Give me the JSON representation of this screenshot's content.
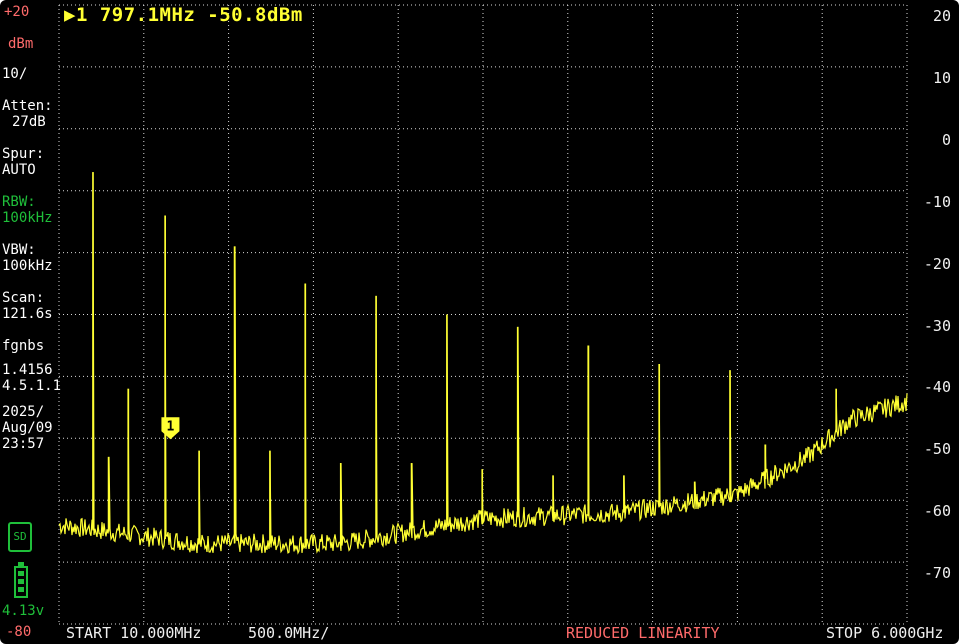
{
  "colors": {
    "trace": "#ffff33",
    "grid": "#ffffff",
    "accent_red": "#ff6b6b",
    "accent_green": "#1fbf3a",
    "text": "#ffffff"
  },
  "marker": {
    "readout": "▶1  797.1MHz -50.8dBm",
    "label": "1"
  },
  "left_panel": {
    "ref_top": "+20",
    "unit": "dBm",
    "scale": "10/",
    "atten_label": "Atten:",
    "atten_value": "27dB",
    "spur_label": "Spur:",
    "spur_value": "AUTO",
    "rbw_label": "RBW:",
    "rbw_value": "100kHz",
    "vbw_label": "VBW:",
    "vbw_value": "100kHz",
    "scan_label": "Scan:",
    "scan_value": "121.6s",
    "device": "fgnbs",
    "ver1": "1.4156",
    "ver2": "4.5.1.1",
    "date1": "2025/",
    "date2": "Aug/09",
    "time": "23:57",
    "sd_label": "SD",
    "battery_voltage": "4.13v",
    "ref_bottom": "-80"
  },
  "right_axis": [
    "20",
    "10",
    "0",
    "-10",
    "-20",
    "-30",
    "-40",
    "-50",
    "-60",
    "-70"
  ],
  "bottom": {
    "start": "START 10.000MHz",
    "per_div": "500.0MHz/",
    "warning": "REDUCED LINEARITY",
    "stop": "STOP 6.000GHz"
  },
  "chart_data": {
    "type": "line",
    "xlabel": "",
    "ylabel": "",
    "xlim": [
      10,
      6000
    ],
    "ylim": [
      -80,
      20
    ],
    "grid": true,
    "x_unit": "MHz",
    "y_unit": "dBm",
    "peaks": [
      {
        "x": 250,
        "y": -7
      },
      {
        "x": 360,
        "y": -53
      },
      {
        "x": 500,
        "y": -42
      },
      {
        "x": 760,
        "y": -14
      },
      {
        "x": 1000,
        "y": -52
      },
      {
        "x": 1250,
        "y": -19
      },
      {
        "x": 1500,
        "y": -52
      },
      {
        "x": 1750,
        "y": -25
      },
      {
        "x": 2000,
        "y": -54
      },
      {
        "x": 2250,
        "y": -27
      },
      {
        "x": 2500,
        "y": -54
      },
      {
        "x": 2750,
        "y": -30
      },
      {
        "x": 3000,
        "y": -55
      },
      {
        "x": 3250,
        "y": -32
      },
      {
        "x": 3500,
        "y": -56
      },
      {
        "x": 3750,
        "y": -35
      },
      {
        "x": 4000,
        "y": -56
      },
      {
        "x": 4250,
        "y": -38
      },
      {
        "x": 4500,
        "y": -57
      },
      {
        "x": 4750,
        "y": -39
      },
      {
        "x": 5000,
        "y": -51
      },
      {
        "x": 5500,
        "y": -42
      }
    ],
    "noise_floor": [
      {
        "x": 10,
        "y": -64
      },
      {
        "x": 1000,
        "y": -67
      },
      {
        "x": 2000,
        "y": -67
      },
      {
        "x": 3000,
        "y": -63
      },
      {
        "x": 4000,
        "y": -62
      },
      {
        "x": 4800,
        "y": -59
      },
      {
        "x": 5300,
        "y": -53
      },
      {
        "x": 5600,
        "y": -47
      },
      {
        "x": 6000,
        "y": -44
      }
    ],
    "marker_point": {
      "x": 797.1,
      "y": -50.8
    }
  }
}
